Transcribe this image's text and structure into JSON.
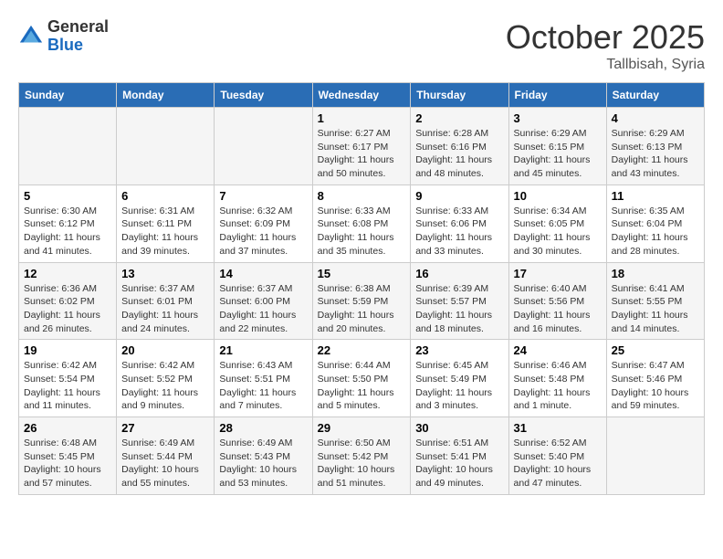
{
  "header": {
    "logo_line1": "General",
    "logo_line2": "Blue",
    "month": "October 2025",
    "location": "Tallbisah, Syria"
  },
  "columns": [
    "Sunday",
    "Monday",
    "Tuesday",
    "Wednesday",
    "Thursday",
    "Friday",
    "Saturday"
  ],
  "weeks": [
    [
      {
        "day": "",
        "info": ""
      },
      {
        "day": "",
        "info": ""
      },
      {
        "day": "",
        "info": ""
      },
      {
        "day": "1",
        "info": "Sunrise: 6:27 AM\nSunset: 6:17 PM\nDaylight: 11 hours and 50 minutes."
      },
      {
        "day": "2",
        "info": "Sunrise: 6:28 AM\nSunset: 6:16 PM\nDaylight: 11 hours and 48 minutes."
      },
      {
        "day": "3",
        "info": "Sunrise: 6:29 AM\nSunset: 6:15 PM\nDaylight: 11 hours and 45 minutes."
      },
      {
        "day": "4",
        "info": "Sunrise: 6:29 AM\nSunset: 6:13 PM\nDaylight: 11 hours and 43 minutes."
      }
    ],
    [
      {
        "day": "5",
        "info": "Sunrise: 6:30 AM\nSunset: 6:12 PM\nDaylight: 11 hours and 41 minutes."
      },
      {
        "day": "6",
        "info": "Sunrise: 6:31 AM\nSunset: 6:11 PM\nDaylight: 11 hours and 39 minutes."
      },
      {
        "day": "7",
        "info": "Sunrise: 6:32 AM\nSunset: 6:09 PM\nDaylight: 11 hours and 37 minutes."
      },
      {
        "day": "8",
        "info": "Sunrise: 6:33 AM\nSunset: 6:08 PM\nDaylight: 11 hours and 35 minutes."
      },
      {
        "day": "9",
        "info": "Sunrise: 6:33 AM\nSunset: 6:06 PM\nDaylight: 11 hours and 33 minutes."
      },
      {
        "day": "10",
        "info": "Sunrise: 6:34 AM\nSunset: 6:05 PM\nDaylight: 11 hours and 30 minutes."
      },
      {
        "day": "11",
        "info": "Sunrise: 6:35 AM\nSunset: 6:04 PM\nDaylight: 11 hours and 28 minutes."
      }
    ],
    [
      {
        "day": "12",
        "info": "Sunrise: 6:36 AM\nSunset: 6:02 PM\nDaylight: 11 hours and 26 minutes."
      },
      {
        "day": "13",
        "info": "Sunrise: 6:37 AM\nSunset: 6:01 PM\nDaylight: 11 hours and 24 minutes."
      },
      {
        "day": "14",
        "info": "Sunrise: 6:37 AM\nSunset: 6:00 PM\nDaylight: 11 hours and 22 minutes."
      },
      {
        "day": "15",
        "info": "Sunrise: 6:38 AM\nSunset: 5:59 PM\nDaylight: 11 hours and 20 minutes."
      },
      {
        "day": "16",
        "info": "Sunrise: 6:39 AM\nSunset: 5:57 PM\nDaylight: 11 hours and 18 minutes."
      },
      {
        "day": "17",
        "info": "Sunrise: 6:40 AM\nSunset: 5:56 PM\nDaylight: 11 hours and 16 minutes."
      },
      {
        "day": "18",
        "info": "Sunrise: 6:41 AM\nSunset: 5:55 PM\nDaylight: 11 hours and 14 minutes."
      }
    ],
    [
      {
        "day": "19",
        "info": "Sunrise: 6:42 AM\nSunset: 5:54 PM\nDaylight: 11 hours and 11 minutes."
      },
      {
        "day": "20",
        "info": "Sunrise: 6:42 AM\nSunset: 5:52 PM\nDaylight: 11 hours and 9 minutes."
      },
      {
        "day": "21",
        "info": "Sunrise: 6:43 AM\nSunset: 5:51 PM\nDaylight: 11 hours and 7 minutes."
      },
      {
        "day": "22",
        "info": "Sunrise: 6:44 AM\nSunset: 5:50 PM\nDaylight: 11 hours and 5 minutes."
      },
      {
        "day": "23",
        "info": "Sunrise: 6:45 AM\nSunset: 5:49 PM\nDaylight: 11 hours and 3 minutes."
      },
      {
        "day": "24",
        "info": "Sunrise: 6:46 AM\nSunset: 5:48 PM\nDaylight: 11 hours and 1 minute."
      },
      {
        "day": "25",
        "info": "Sunrise: 6:47 AM\nSunset: 5:46 PM\nDaylight: 10 hours and 59 minutes."
      }
    ],
    [
      {
        "day": "26",
        "info": "Sunrise: 6:48 AM\nSunset: 5:45 PM\nDaylight: 10 hours and 57 minutes."
      },
      {
        "day": "27",
        "info": "Sunrise: 6:49 AM\nSunset: 5:44 PM\nDaylight: 10 hours and 55 minutes."
      },
      {
        "day": "28",
        "info": "Sunrise: 6:49 AM\nSunset: 5:43 PM\nDaylight: 10 hours and 53 minutes."
      },
      {
        "day": "29",
        "info": "Sunrise: 6:50 AM\nSunset: 5:42 PM\nDaylight: 10 hours and 51 minutes."
      },
      {
        "day": "30",
        "info": "Sunrise: 6:51 AM\nSunset: 5:41 PM\nDaylight: 10 hours and 49 minutes."
      },
      {
        "day": "31",
        "info": "Sunrise: 6:52 AM\nSunset: 5:40 PM\nDaylight: 10 hours and 47 minutes."
      },
      {
        "day": "",
        "info": ""
      }
    ]
  ]
}
